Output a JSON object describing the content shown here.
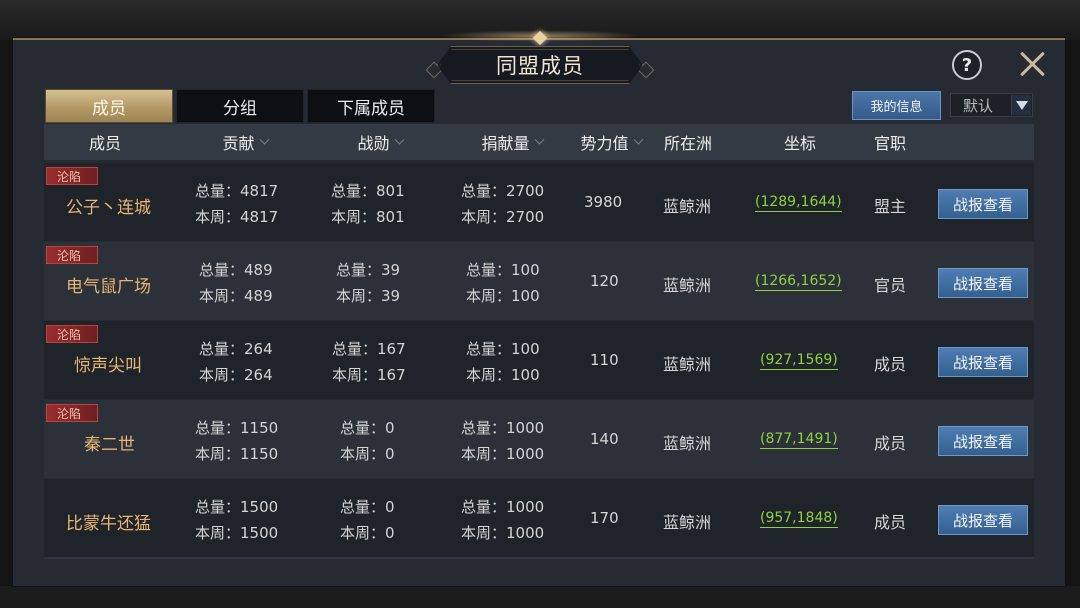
{
  "title": "同盟成员",
  "tabs": [
    {
      "label": "成员",
      "active": true
    },
    {
      "label": "分组",
      "active": false
    },
    {
      "label": "下属成员",
      "active": false
    }
  ],
  "my_info_label": "我的信息",
  "sort_select": {
    "value": "默认"
  },
  "help_label": "?",
  "headers": [
    "成员",
    "贡献",
    "战勋",
    "捐献量",
    "势力值",
    "所在洲",
    "坐标",
    "官职"
  ],
  "labels": {
    "total_prefix": "总量：",
    "week_prefix": "本周：",
    "report_button": "战报查看"
  },
  "colors": {
    "accent_gold": "#e7b673",
    "coord_green": "#8dd33f",
    "button_blue": "#4f7db2",
    "status_red": "#9a2d2d"
  },
  "rows": [
    {
      "status": "沦陷",
      "name": "公子丶连城",
      "contribution": {
        "total": "4817",
        "week": "4817"
      },
      "merit": {
        "total": "801",
        "week": "801"
      },
      "donation": {
        "total": "2700",
        "week": "2700"
      },
      "power": "3980",
      "region": "蓝鲸洲",
      "coords": "(1289,1644)",
      "role": "盟主"
    },
    {
      "status": "沦陷",
      "name": "电气鼠广场",
      "contribution": {
        "total": "489",
        "week": "489"
      },
      "merit": {
        "total": "39",
        "week": "39"
      },
      "donation": {
        "total": "100",
        "week": "100"
      },
      "power": "120",
      "region": "蓝鲸洲",
      "coords": "(1266,1652)",
      "role": "官员"
    },
    {
      "status": "沦陷",
      "name": "惊声尖叫",
      "contribution": {
        "total": "264",
        "week": "264"
      },
      "merit": {
        "total": "167",
        "week": "167"
      },
      "donation": {
        "total": "100",
        "week": "100"
      },
      "power": "110",
      "region": "蓝鲸洲",
      "coords": "(927,1569)",
      "role": "成员"
    },
    {
      "status": "沦陷",
      "name": "秦二世",
      "contribution": {
        "total": "1150",
        "week": "1150"
      },
      "merit": {
        "total": "0",
        "week": "0"
      },
      "donation": {
        "total": "1000",
        "week": "1000"
      },
      "power": "140",
      "region": "蓝鲸洲",
      "coords": "(877,1491)",
      "role": "成员"
    },
    {
      "status": "",
      "name": "比蒙牛还猛",
      "contribution": {
        "total": "1500",
        "week": "1500"
      },
      "merit": {
        "total": "0",
        "week": "0"
      },
      "donation": {
        "total": "1000",
        "week": "1000"
      },
      "power": "170",
      "region": "蓝鲸洲",
      "coords": "(957,1848)",
      "role": "成员"
    }
  ]
}
